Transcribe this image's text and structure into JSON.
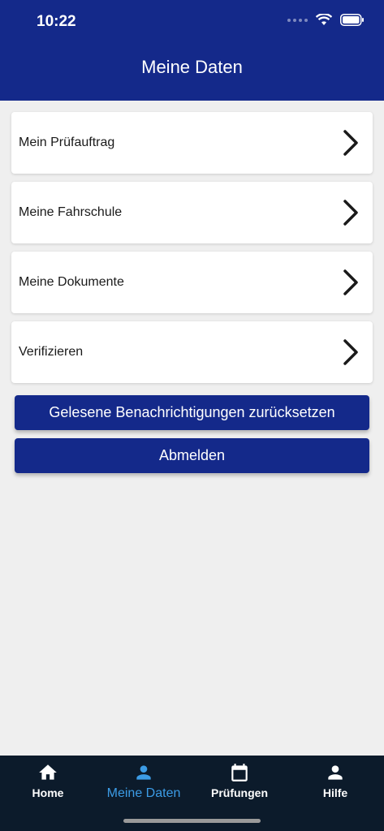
{
  "status_bar": {
    "time": "10:22"
  },
  "header": {
    "title": "Meine Daten"
  },
  "menu": {
    "items": [
      {
        "label": "Mein Prüfauftrag"
      },
      {
        "label": "Meine Fahrschule"
      },
      {
        "label": "Meine Dokumente"
      },
      {
        "label": "Verifizieren"
      }
    ]
  },
  "actions": {
    "reset_label": "Gelesene Benachrichtigungen zurücksetzen",
    "logout_label": "Abmelden"
  },
  "tabbar": {
    "tabs": [
      {
        "label": "Home",
        "icon": "home-icon"
      },
      {
        "label": "Meine Daten",
        "icon": "person-icon",
        "active": true
      },
      {
        "label": "Prüfungen",
        "icon": "calendar-icon"
      },
      {
        "label": "Hilfe",
        "icon": "person-icon"
      }
    ]
  },
  "colors": {
    "primary": "#14298a",
    "tabbar_bg": "#0c1b2b",
    "active_tab": "#3c9ce6",
    "background": "#efefef"
  }
}
